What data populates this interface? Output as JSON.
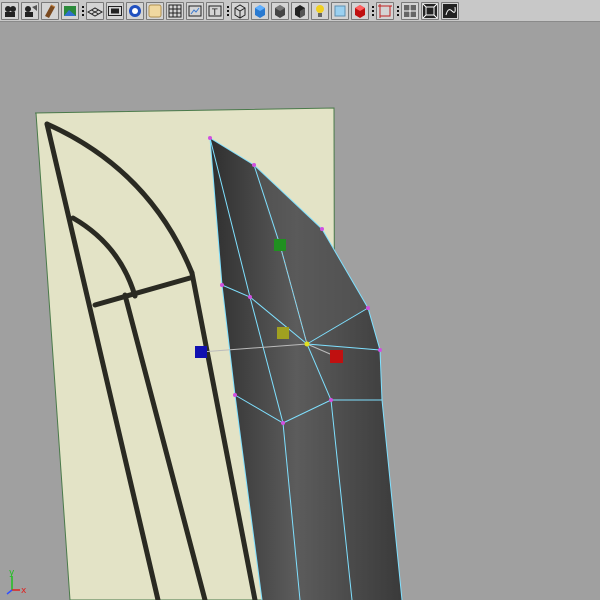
{
  "toolbar": {
    "buttons": [
      {
        "name": "camera-icon"
      },
      {
        "name": "camera-attributes-icon"
      },
      {
        "name": "bookmark-icon"
      },
      {
        "name": "image-plane-icon"
      },
      {
        "sep": true
      },
      {
        "name": "grid-icon"
      },
      {
        "name": "film-gate-icon"
      },
      {
        "name": "resolution-gate-icon"
      },
      {
        "name": "gate-mask-icon"
      },
      {
        "name": "field-chart-icon"
      },
      {
        "name": "safe-action-icon"
      },
      {
        "name": "safe-title-icon"
      },
      {
        "sep": true
      },
      {
        "name": "wireframe-icon"
      },
      {
        "name": "smooth-shade-icon"
      },
      {
        "name": "flat-shade-icon"
      },
      {
        "name": "default-material-icon"
      },
      {
        "name": "use-lights-icon"
      },
      {
        "name": "xray-icon"
      },
      {
        "name": "texture-icon"
      },
      {
        "sep": true
      },
      {
        "name": "isolate-select-icon"
      },
      {
        "sep": true
      },
      {
        "name": "wireframe-on-shaded-icon"
      },
      {
        "name": "frame-all-icon"
      },
      {
        "name": "frame-selected-icon"
      }
    ]
  },
  "colors": {
    "viewport_bg": "#a0a0a0",
    "image_plane": "#e3e3c6",
    "mesh_light": "#7a7a7a",
    "mesh_dark": "#3a3a3a",
    "wire": "#7fe0ff",
    "vertex": "#d050e0",
    "manip_x": "#c01010",
    "manip_y": "#209020",
    "manip_z": "#1010b0",
    "manip_center": "#a0a020",
    "axis_x": "#e02020",
    "axis_y": "#20c020"
  },
  "axis": {
    "x_label": "x",
    "y_label": "y"
  }
}
